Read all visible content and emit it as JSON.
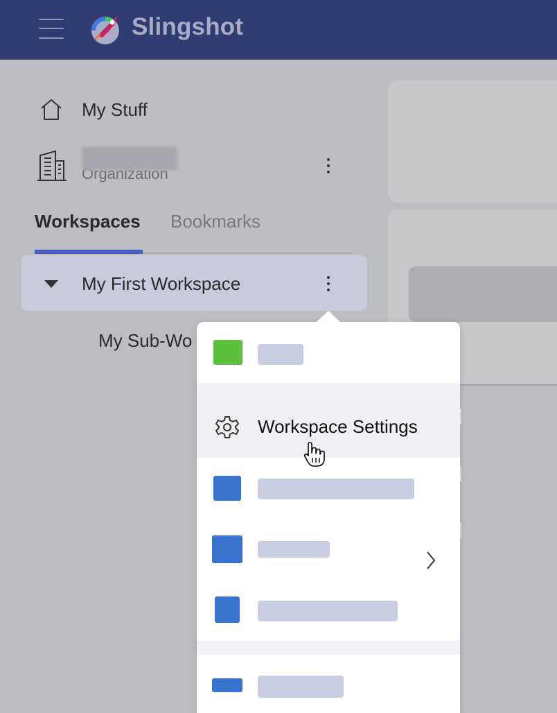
{
  "header": {
    "menu_icon": "hamburger-icon",
    "logo_icon": "slingshot-logo",
    "app_name": "Slingshot"
  },
  "sidebar": {
    "my_stuff": {
      "icon": "home-icon",
      "label": "My Stuff"
    },
    "organization": {
      "icon": "building-icon",
      "subtitle": "Organization"
    },
    "tabs": [
      {
        "label": "Workspaces",
        "active": true
      },
      {
        "label": "Bookmarks",
        "active": false
      }
    ],
    "workspace": {
      "label": "My First Workspace",
      "expanded": true
    },
    "sub_workspace": {
      "label": "My Sub-Wo"
    }
  },
  "menu": {
    "items": [
      {
        "icon_color": "#5bbf3e"
      },
      {
        "icon": "gear-icon",
        "label": "Workspace Settings"
      },
      {
        "icon_color": "#3a72cf"
      },
      {
        "icon_color": "#3a72cf",
        "has_submenu": true
      },
      {
        "icon_color": "#3a72cf"
      },
      {
        "icon_color": "#3a72cf"
      }
    ]
  },
  "colors": {
    "header_bg": "#313b73",
    "accent": "#4b5bc0",
    "selected_row": "#c9cbdd"
  }
}
